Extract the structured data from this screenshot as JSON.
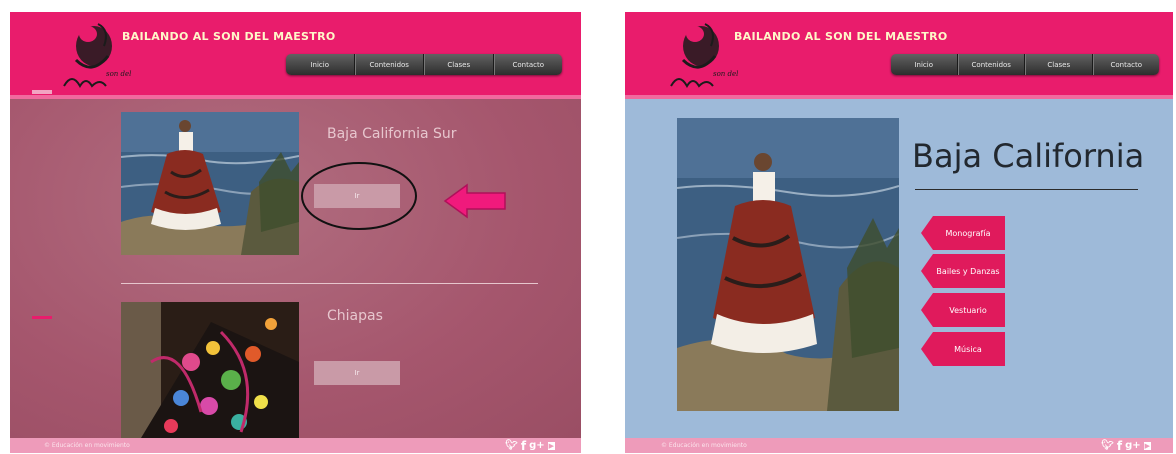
{
  "left_page": {
    "brand_title": "BAILANDO AL SON DEL MAESTRO",
    "nav": [
      "Inicio",
      "Contenidos",
      "Clases",
      "Contacto"
    ],
    "states": [
      {
        "title": "Baja California Sur",
        "button": "Ir"
      },
      {
        "title": "Chiapas",
        "button": "Ir"
      }
    ],
    "footer_text": "© Educación en movimiento",
    "social_icons": [
      "twitter-icon",
      "facebook-icon",
      "google-plus-icon",
      "youtube-icon"
    ]
  },
  "right_page": {
    "brand_title": "BAILANDO AL SON DEL MAESTRO",
    "nav": [
      "Inicio",
      "Contenidos",
      "Clases",
      "Contacto"
    ],
    "heading": "Baja California",
    "menu": [
      "Monografía",
      "Bailes y Danzas",
      "Vestuario",
      "Música"
    ],
    "footer_text": "© Educación en movimiento",
    "social_icons": [
      "twitter-icon",
      "facebook-icon",
      "google-plus-icon",
      "youtube-icon"
    ]
  },
  "colors": {
    "header_pink": "#e91c6c",
    "left_background": "#a5566d",
    "right_background": "#9ebad9",
    "menu_button": "#e01a5c",
    "annotation_arrow": "#f01a7c"
  }
}
